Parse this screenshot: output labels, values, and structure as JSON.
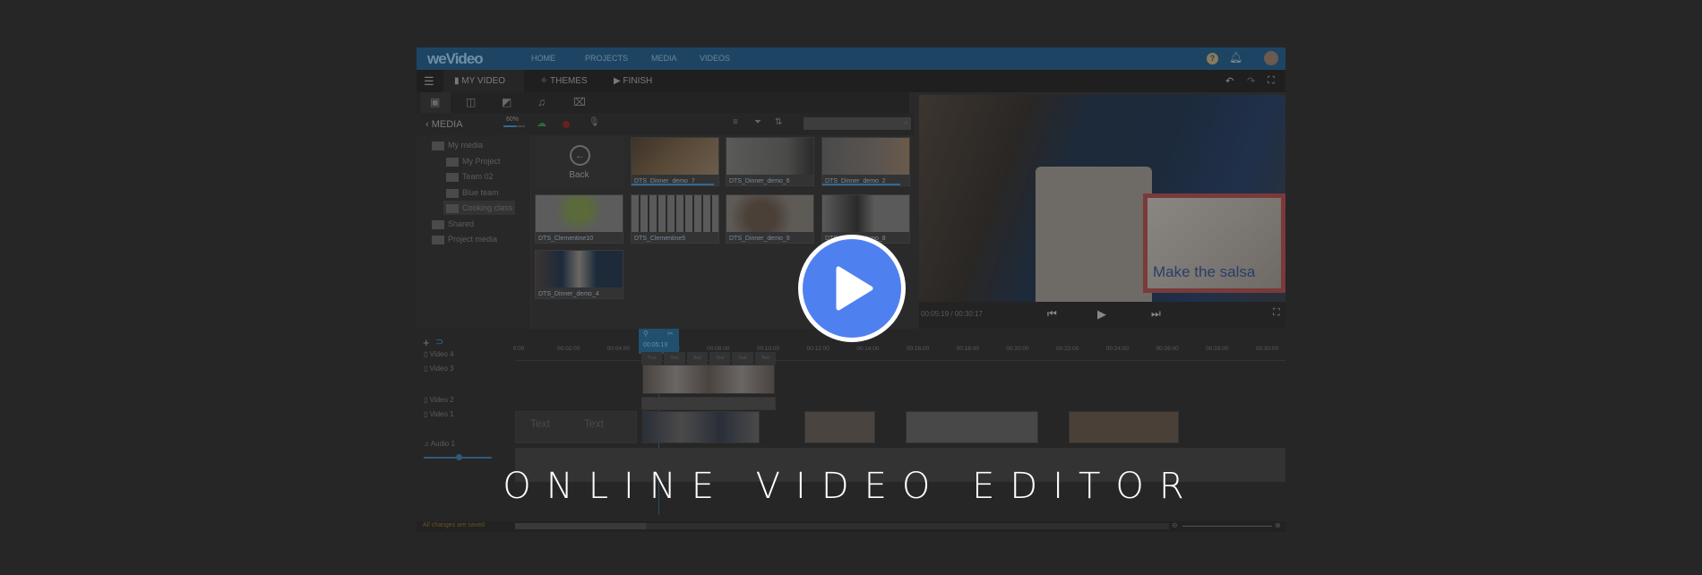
{
  "app": {
    "logo": "weVideo",
    "nav": [
      "HOME",
      "PROJECTS",
      "MEDIA",
      "VIDEOS"
    ],
    "tabs": [
      "MY VIDEO",
      "THEMES",
      "FINISH"
    ],
    "media": {
      "back_label": "MEDIA",
      "storage": "60%",
      "storage_fraction": 0.6,
      "folders": [
        "My media",
        "My Project",
        "Team 02",
        "Blue team",
        "Cooking class",
        "Shared",
        "Project media"
      ],
      "back_tile": "Back",
      "thumbnails": [
        "DTS_Dinner_demo_7",
        "DTS_Dinner_demo_6",
        "DTS_Dinner_demo_2",
        "DTS_Clementine10",
        "DTS_Clementine5",
        "DTS_Dinner_demo_9",
        "DTS_Dinner_demo_8",
        "DTS_Dinner_demo_4"
      ]
    },
    "preview": {
      "overlay_text": "Make the salsa",
      "time": "00:05:19 / 00:30:17"
    },
    "timeline": {
      "playhead": "00:05:19",
      "ruler": [
        "0:00",
        "00:02:00",
        "00:04:00",
        "00:06:00",
        "00:08:00",
        "00:10:00",
        "00:12:00",
        "00:14:00",
        "00:16:00",
        "00:18:00",
        "00:20:00",
        "00:22:00",
        "00:24:00",
        "00:26:00",
        "00:28:00",
        "00:30:00"
      ],
      "tracks": [
        "Video 4",
        "Video 3",
        "Video 2",
        "Video 1",
        "Audio 1"
      ],
      "text_clip": "Text",
      "small_text_clips": [
        "Text",
        "Text",
        "Text",
        "Text",
        "Text",
        "Text"
      ]
    },
    "status": "All changes are saved"
  },
  "headline": "ONLINE VIDEO EDITOR",
  "colors": {
    "accent": "#4f80f0",
    "topbar": "#1d4563",
    "background": "#262626"
  }
}
